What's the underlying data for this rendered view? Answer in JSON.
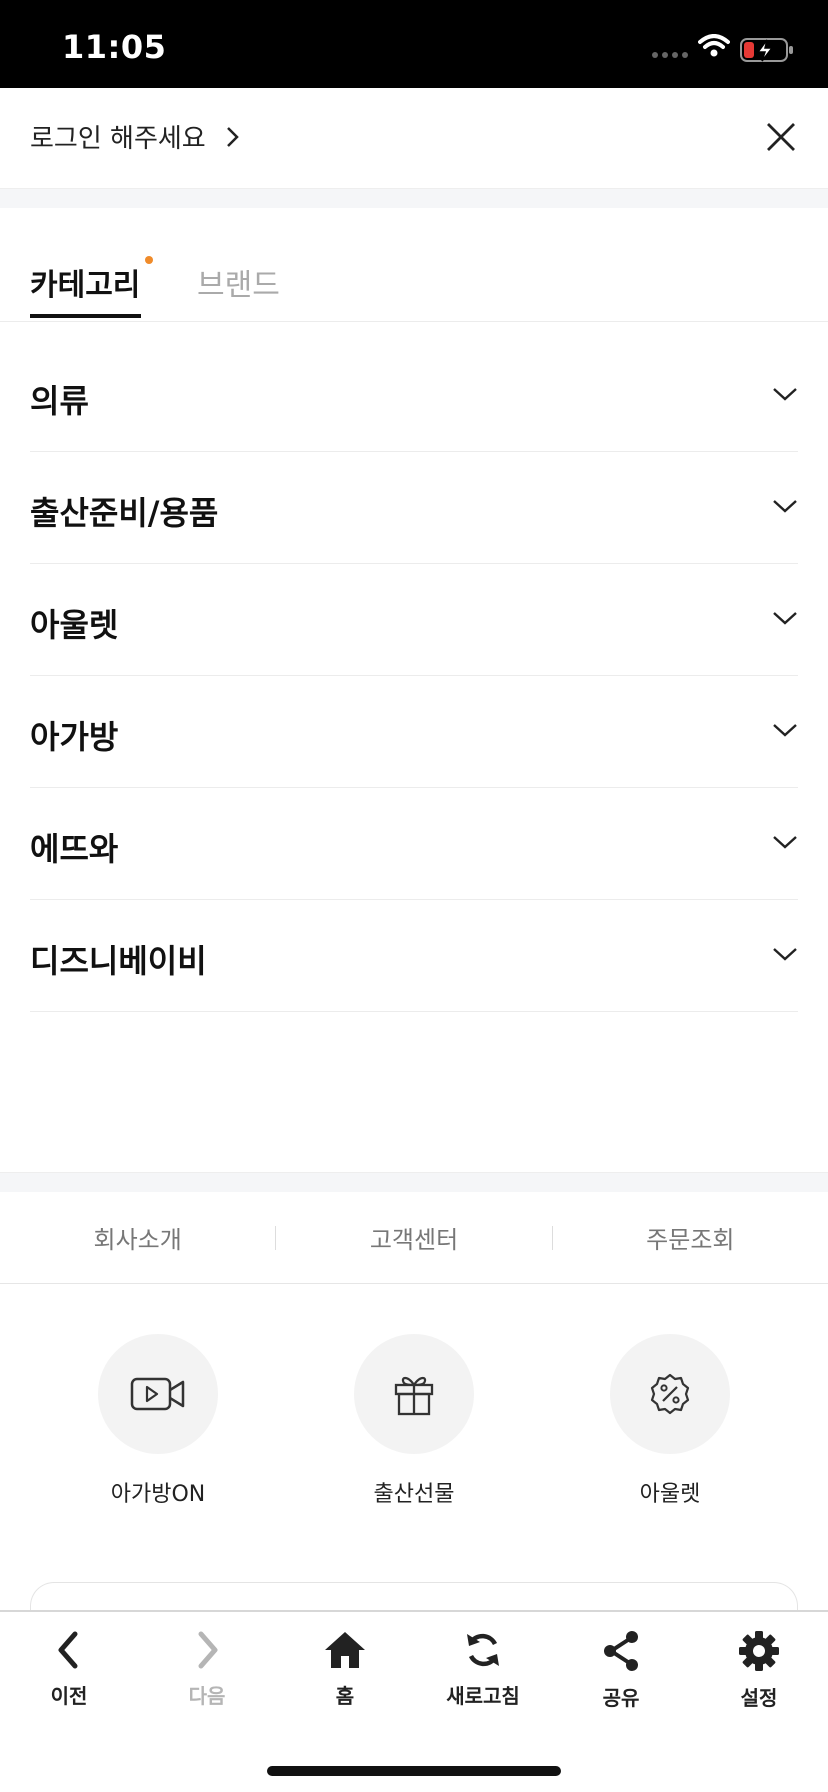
{
  "status_bar": {
    "time": "11:05"
  },
  "header": {
    "login_label": "로그인 해주세요"
  },
  "tabs": [
    {
      "label": "카테고리",
      "active": true,
      "has_dot": true
    },
    {
      "label": "브랜드",
      "active": false
    }
  ],
  "categories": [
    {
      "label": "의류"
    },
    {
      "label": "출산준비/용품"
    },
    {
      "label": "아울렛"
    },
    {
      "label": "아가방"
    },
    {
      "label": "에뜨와"
    },
    {
      "label": "디즈니베이비"
    }
  ],
  "footer_links": [
    {
      "label": "회사소개"
    },
    {
      "label": "고객센터"
    },
    {
      "label": "주문조회"
    }
  ],
  "quick_menu": [
    {
      "label": "아가방ON",
      "icon": "video-camera-icon"
    },
    {
      "label": "출산선물",
      "icon": "gift-icon"
    },
    {
      "label": "아울렛",
      "icon": "discount-badge-icon"
    }
  ],
  "toolbar": [
    {
      "label": "이전",
      "icon": "back-arrow-icon",
      "enabled": true
    },
    {
      "label": "다음",
      "icon": "forward-arrow-icon",
      "enabled": false
    },
    {
      "label": "홈",
      "icon": "home-icon",
      "enabled": true
    },
    {
      "label": "새로고침",
      "icon": "refresh-icon",
      "enabled": true
    },
    {
      "label": "공유",
      "icon": "share-icon",
      "enabled": true
    },
    {
      "label": "설정",
      "icon": "gear-icon",
      "enabled": true
    }
  ],
  "colors": {
    "accent_dot": "#f08b2a",
    "text_primary": "#111111",
    "text_muted": "#aaaaaa",
    "band_gray": "#f5f6f8"
  }
}
